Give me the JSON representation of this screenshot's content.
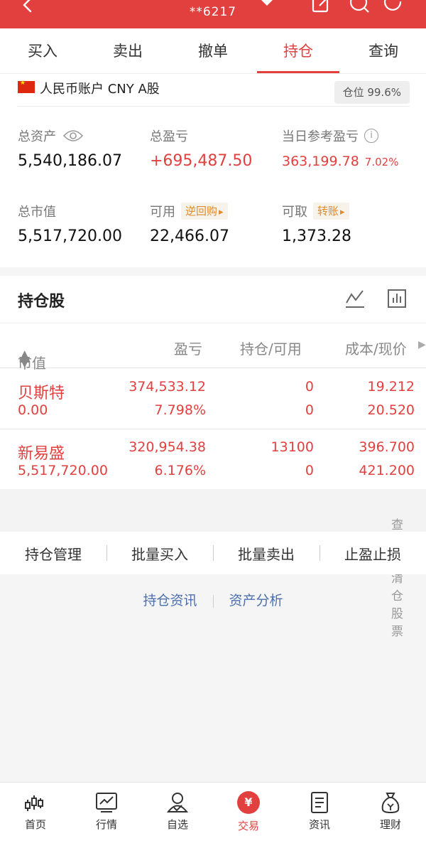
{
  "header": {
    "account_masked": "**6217"
  },
  "tabs": [
    {
      "label": "买入"
    },
    {
      "label": "卖出"
    },
    {
      "label": "撤单"
    },
    {
      "label": "持仓",
      "active": true
    },
    {
      "label": "查询"
    }
  ],
  "account": {
    "name": "人民币账户 CNY A股",
    "position_badge": "仓位 99.6%"
  },
  "metrics": {
    "total_assets_label": "总资产",
    "total_assets": "5,540,186.07",
    "total_pl_label": "总盈亏",
    "total_pl": "+695,487.50",
    "daily_pl_label": "当日参考盈亏",
    "daily_pl": "363,199.78",
    "daily_pl_pct": "7.02%",
    "market_value_label": "总市值",
    "market_value": "5,517,720.00",
    "available_label": "可用",
    "available_chip": "逆回购",
    "available": "22,466.07",
    "withdrawable_label": "可取",
    "withdrawable_chip": "转账",
    "withdrawable": "1,373.28"
  },
  "holdings": {
    "title": "持仓股",
    "columns": [
      "市值",
      "盈亏",
      "持仓/可用",
      "成本/现价"
    ],
    "rows": [
      {
        "name": "贝斯特",
        "market_value": "0.00",
        "pl": "374,533.12",
        "pl_pct": "7.798%",
        "position": "0",
        "available": "0",
        "cost": "19.212",
        "price": "20.520"
      },
      {
        "name": "新易盛",
        "market_value": "5,517,720.00",
        "pl": "320,954.38",
        "pl_pct": "6.176%",
        "position": "13100",
        "available": "0",
        "cost": "396.700",
        "price": "421.200"
      }
    ],
    "cleared_link": "查看已清仓股票"
  },
  "actions": [
    {
      "label": "持仓管理"
    },
    {
      "label": "批量买入"
    },
    {
      "label": "批量卖出"
    },
    {
      "label": "止盈止损"
    }
  ],
  "links": {
    "news": "持仓资讯",
    "analysis": "资产分析"
  },
  "bottom_nav": [
    {
      "label": "首页",
      "icon": "candlestick-icon"
    },
    {
      "label": "行情",
      "icon": "chart-monitor-icon"
    },
    {
      "label": "自选",
      "icon": "user-check-icon"
    },
    {
      "label": "交易",
      "icon": "yen-icon",
      "active": true
    },
    {
      "label": "资讯",
      "icon": "document-icon"
    },
    {
      "label": "理财",
      "icon": "money-bag-icon"
    }
  ],
  "colors": {
    "brand_red": "#e2403f",
    "link_blue": "#4c6fb0",
    "chip_orange": "#e08a2e"
  }
}
